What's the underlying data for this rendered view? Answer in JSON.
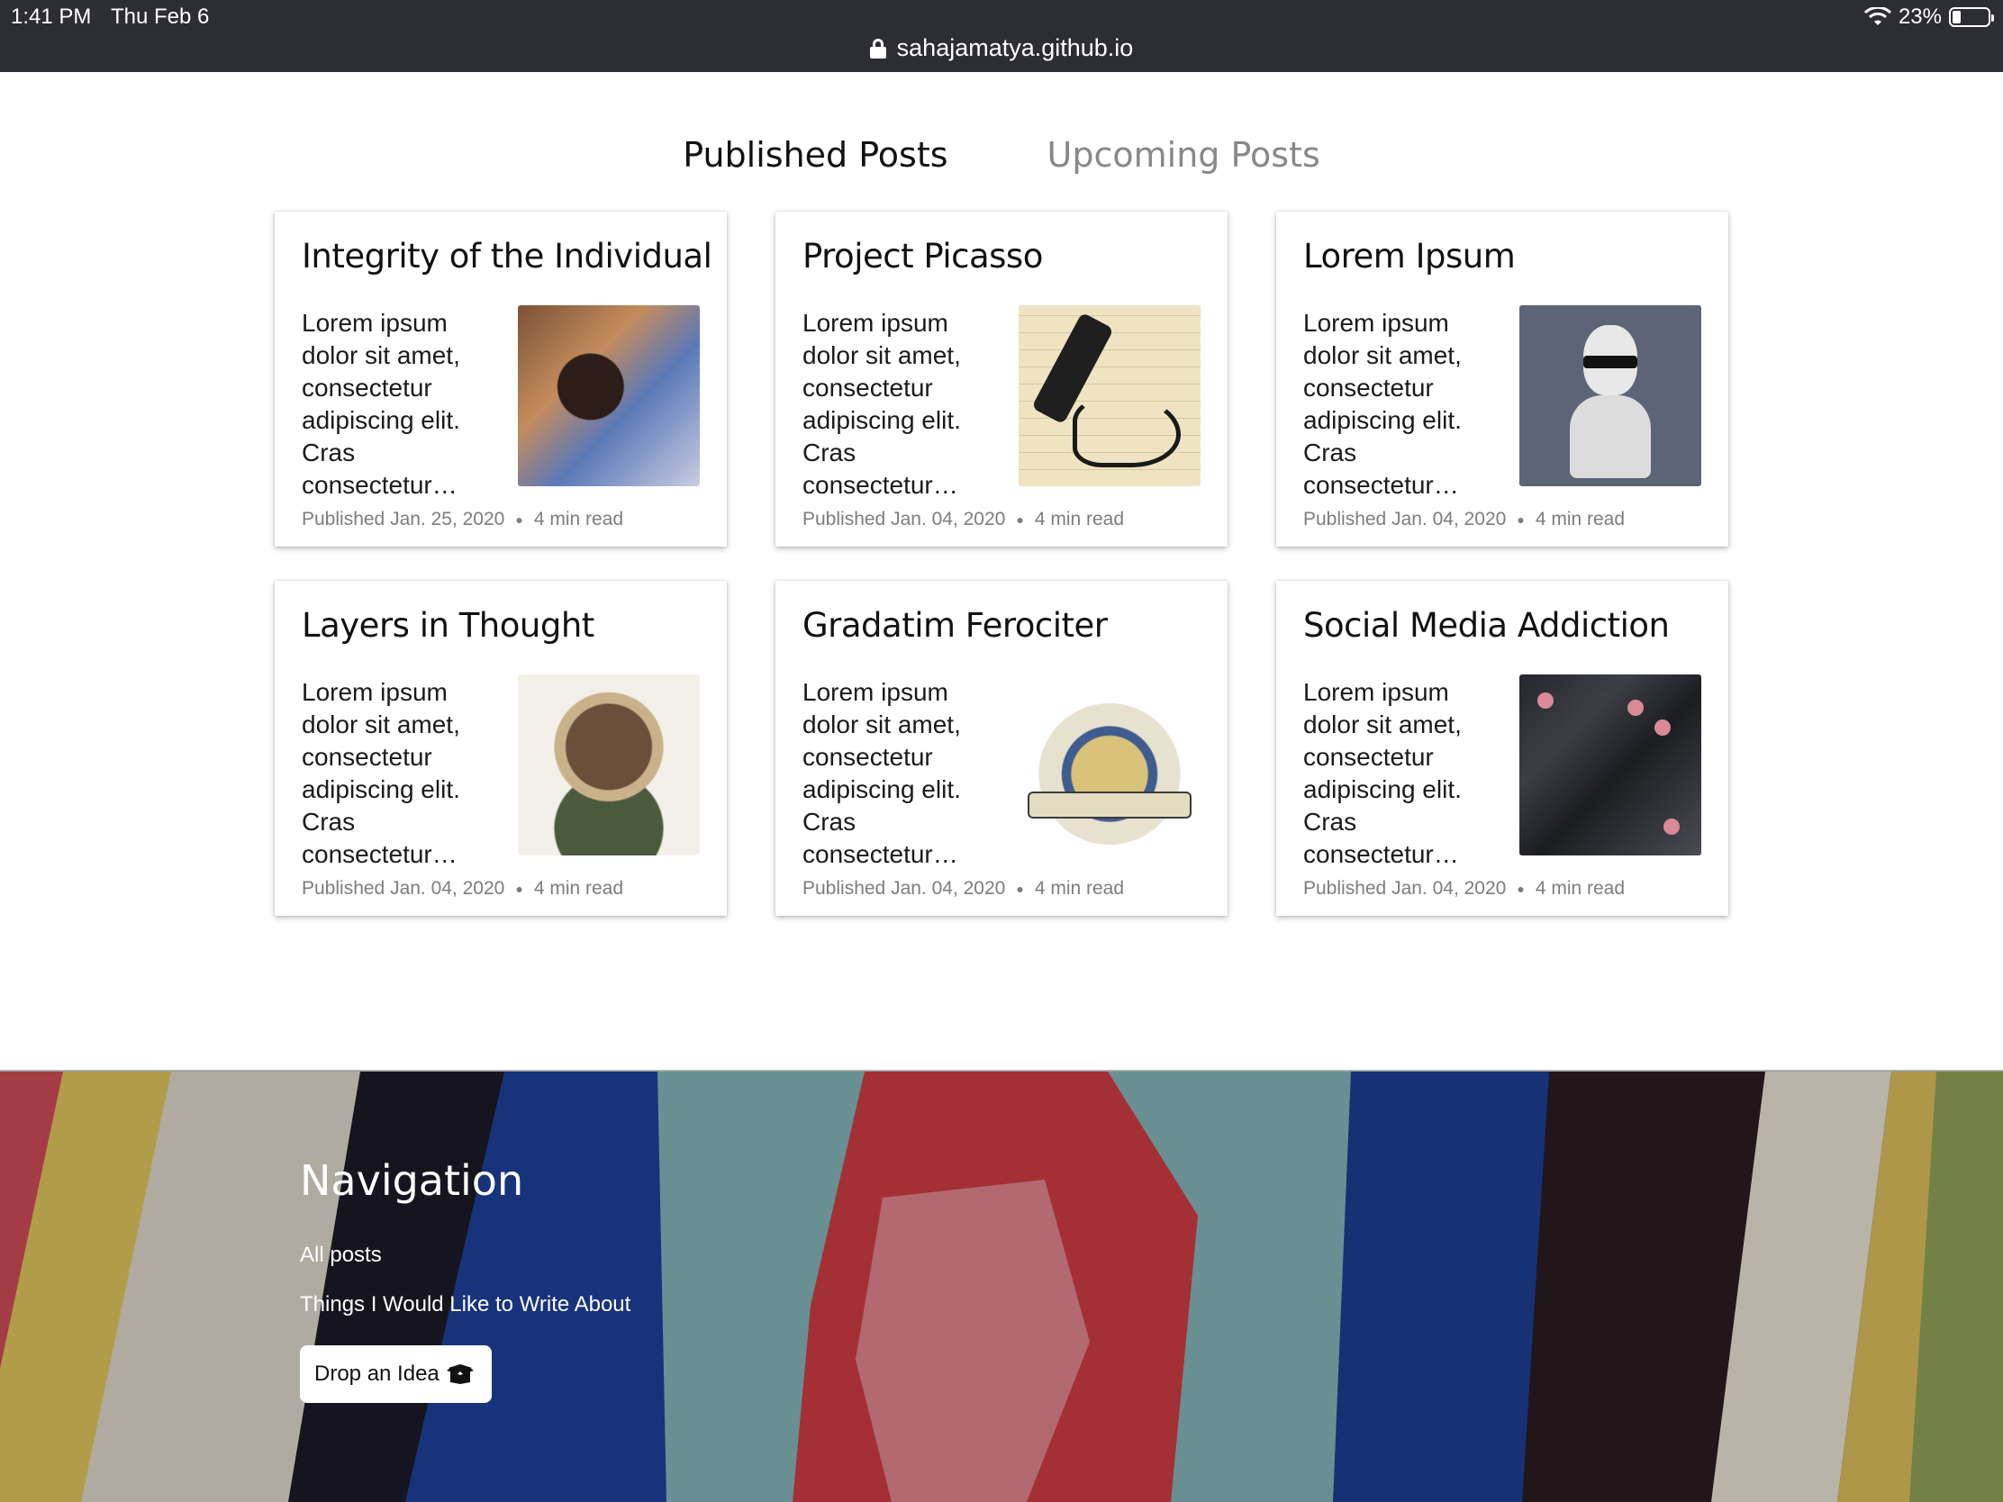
{
  "status_bar": {
    "time": "1:41 PM",
    "date": "Thu Feb 6",
    "battery": "23%",
    "battery_level": 0.23
  },
  "browser": {
    "url": "sahajamatya.github.io"
  },
  "tabs": [
    {
      "label": "Published Posts",
      "active": true
    },
    {
      "label": "Upcoming Posts",
      "active": false
    }
  ],
  "posts": [
    {
      "title": "Integrity of the Individual",
      "excerpt": "Lorem ipsum dolor sit amet, consectetur adipiscing elit. Cras consectetur…",
      "published": "Published Jan. 25, 2020",
      "read_time": "4 min read",
      "thumbnail": "watercolor-portrait"
    },
    {
      "title": "Project Picasso",
      "excerpt": "Lorem ipsum dolor sit amet, consectetur adipiscing elit. Cras consectetur…",
      "published": "Published Jan. 04, 2020",
      "read_time": "4 min read",
      "thumbnail": "pen-scribble"
    },
    {
      "title": "Lorem Ipsum",
      "excerpt": "Lorem ipsum dolor sit amet, consectetur adipiscing elit. Cras consectetur…",
      "published": "Published Jan. 04, 2020",
      "read_time": "4 min read",
      "thumbnail": "bust-with-sunglasses"
    },
    {
      "title": "Layers in Thought",
      "excerpt": "Lorem ipsum dolor sit amet, consectetur adipiscing elit. Cras consectetur…",
      "published": "Published Jan. 04, 2020",
      "read_time": "4 min read",
      "thumbnail": "collage-head"
    },
    {
      "title": "Gradatim Ferociter",
      "excerpt": "Lorem ipsum dolor sit amet, consectetur adipiscing elit. Cras consectetur…",
      "published": "Published Jan. 04, 2020",
      "read_time": "4 min read",
      "thumbnail": "emblem-crest"
    },
    {
      "title": "Social Media Addiction",
      "excerpt": "Lorem ipsum dolor sit amet, consectetur adipiscing elit. Cras consectetur…",
      "published": "Published Jan. 04, 2020",
      "read_time": "4 min read",
      "thumbnail": "circuit-board"
    }
  ],
  "footer": {
    "heading": "Navigation",
    "links": [
      {
        "label": "All posts"
      },
      {
        "label": "Things I Would Like to Write About"
      }
    ],
    "button_label": "Drop an Idea",
    "button_icon": "box-icon"
  },
  "colors": {
    "topbar": "#2d2e33",
    "tab_active": "#111111",
    "tab_inactive": "#888888",
    "meta_text": "#7d7d7d"
  }
}
